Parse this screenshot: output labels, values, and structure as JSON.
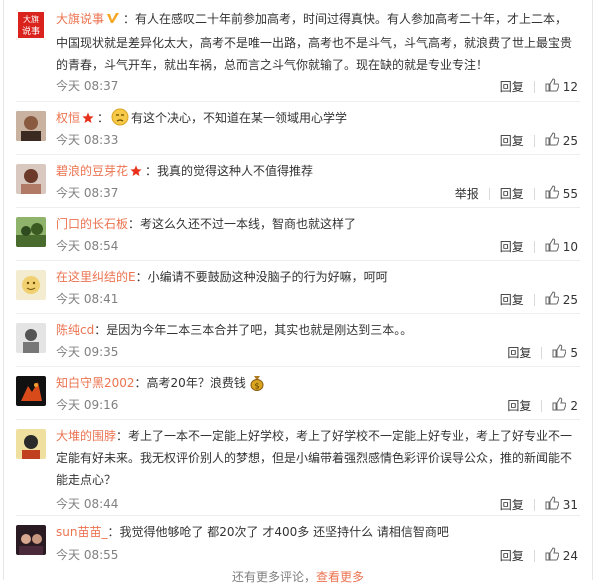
{
  "comments": [
    {
      "user": "大旗说事",
      "badge": "verified-v",
      "text": "：有人在感叹二十年前参加高考，时间过得真快。有人参加高考二十年，才上二本，中国现状就是差异化太大，高考不是唯一出路，高考也不是斗气，斗气高考，就浪费了世上最宝贵的青春，斗气开车，就出车祸，总而言之斗气你就输了。现在缺的就是专业专注！",
      "time": "今天 08:37",
      "reply": "回复",
      "likes": "12",
      "avatar_text": "大旗\n说事",
      "avatar_color": "#d9231c"
    },
    {
      "user": "权恒",
      "badge": "star",
      "text": "有这个决心，不知道在某一领域用心学学",
      "emoji_before": "sad",
      "time": "今天 08:33",
      "reply": "回复",
      "likes": "25",
      "avatar_color": "#6b4a3a"
    },
    {
      "user": "碧浪的豆芽花",
      "badge": "star",
      "text": "：我真的觉得这种人不值得推荐",
      "time": "今天 08:37",
      "report": "举报",
      "reply": "回复",
      "likes": "55",
      "avatar_color": "#8c6b5b"
    },
    {
      "user": "门口的长石板",
      "text": "：考这么久还不过一本线，智商也就这样了",
      "time": "今天 08:54",
      "reply": "回复",
      "likes": "10",
      "avatar_color": "#4a6b2e"
    },
    {
      "user": "在这里纠结的E",
      "text": "：小编请不要鼓励这种没脑子的行为好嘛，呵呵",
      "time": "今天 08:41",
      "reply": "回复",
      "likes": "25",
      "avatar_color": "#f0e2b0"
    },
    {
      "user": "陈纯cd",
      "text": "：是因为今年二本三本合并了吧，其实也就是刚达到三本。。",
      "time": "今天 09:35",
      "reply": "回复",
      "likes": "5",
      "avatar_color": "#d8d8d8"
    },
    {
      "user": "知白守黑2002",
      "text": "：高考20年？浪费钱",
      "emoji_after": "money-bag",
      "time": "今天 09:16",
      "reply": "回复",
      "likes": "2",
      "avatar_color": "#1a1a1a"
    },
    {
      "user": "大堆的围脖",
      "text": "：考上了一本不一定能上好学校，考上了好学校不一定能上好专业，考上了好专业不一定能有好未来。我无权评价别人的梦想，但是小编带着强烈感情色彩评价误导公众，推的新闻能不能走点心？",
      "time": "今天 08:44",
      "reply": "回复",
      "likes": "31",
      "avatar_color": "#e8c45a"
    },
    {
      "user": "sun苗苗_",
      "text": "：我觉得他够呛了 都20次了 才400多 还坚持什么 请相信智商吧",
      "time": "今天 08:55",
      "reply": "回复",
      "likes": "24",
      "avatar_color": "#3a2a2a"
    }
  ],
  "footer": {
    "text": "还有更多评论，",
    "more": "查看更多"
  }
}
